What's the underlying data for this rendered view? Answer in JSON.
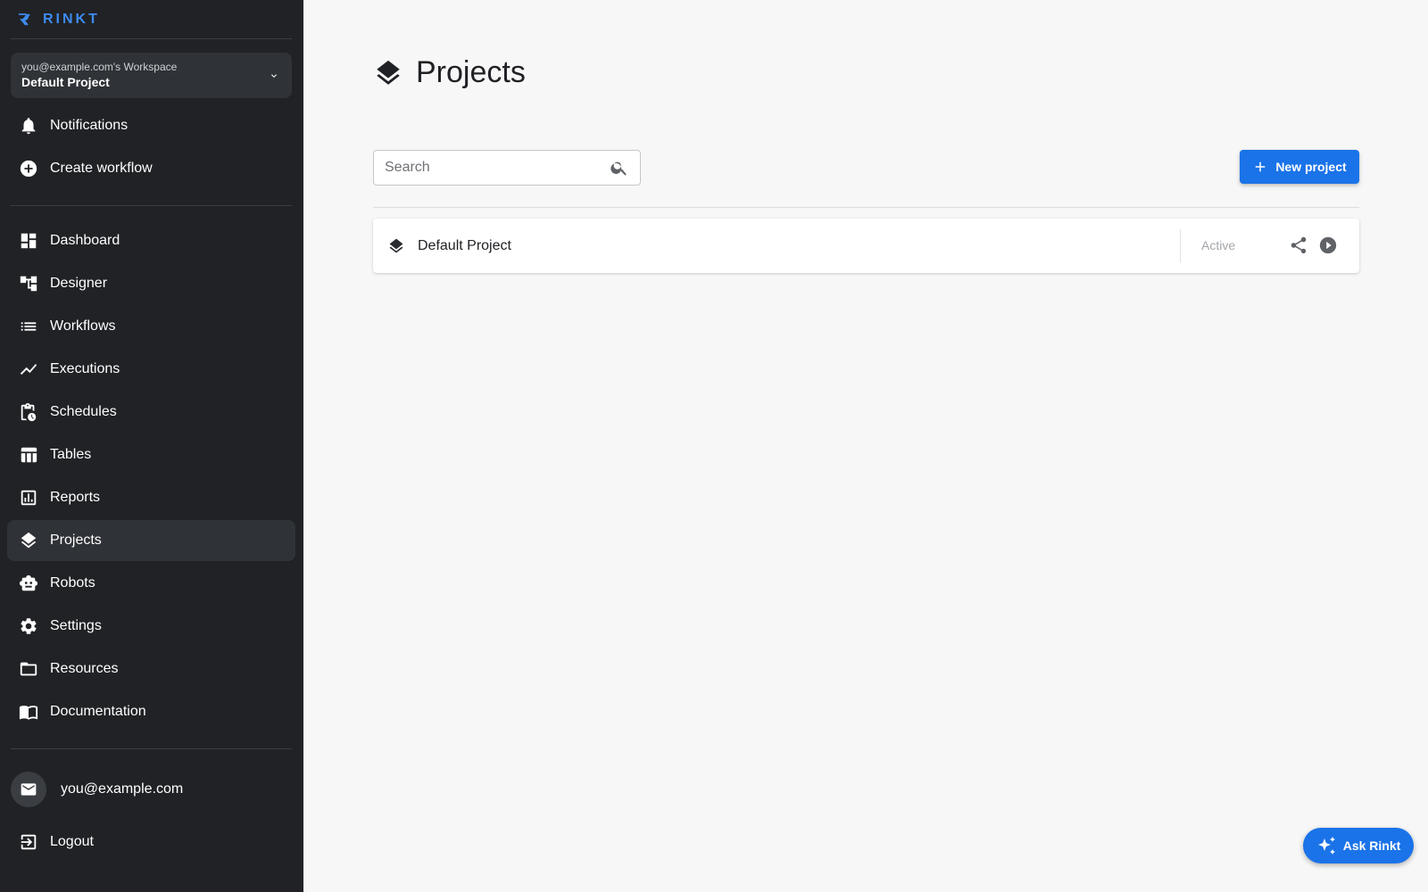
{
  "brand": {
    "name": "RINKT",
    "color": "#3d8bf0"
  },
  "workspace": {
    "label": "you@example.com's Workspace",
    "project": "Default Project"
  },
  "sidebar": {
    "top_items": [
      {
        "label": "Notifications",
        "icon": "bell-icon"
      },
      {
        "label": "Create workflow",
        "icon": "add-circle-icon"
      }
    ],
    "items": [
      {
        "label": "Dashboard",
        "icon": "dashboard-icon"
      },
      {
        "label": "Designer",
        "icon": "designer-icon"
      },
      {
        "label": "Workflows",
        "icon": "list-icon"
      },
      {
        "label": "Executions",
        "icon": "trend-icon"
      },
      {
        "label": "Schedules",
        "icon": "schedule-icon"
      },
      {
        "label": "Tables",
        "icon": "table-icon"
      },
      {
        "label": "Reports",
        "icon": "report-icon"
      },
      {
        "label": "Projects",
        "icon": "layers-icon",
        "active": true
      },
      {
        "label": "Robots",
        "icon": "robot-icon"
      },
      {
        "label": "Settings",
        "icon": "gear-icon"
      },
      {
        "label": "Resources",
        "icon": "folder-icon"
      },
      {
        "label": "Documentation",
        "icon": "book-icon"
      }
    ],
    "user_email": "you@example.com",
    "logout_label": "Logout"
  },
  "main": {
    "title": "Projects",
    "search": {
      "placeholder": "Search",
      "value": ""
    },
    "new_project_label": "New project",
    "projects": [
      {
        "name": "Default Project",
        "status": "Active"
      }
    ]
  },
  "ask_label": "Ask Rinkt",
  "colors": {
    "sidebar_bg": "#202225",
    "accent": "#1a73e8",
    "page_bg": "#f7f7f7"
  }
}
